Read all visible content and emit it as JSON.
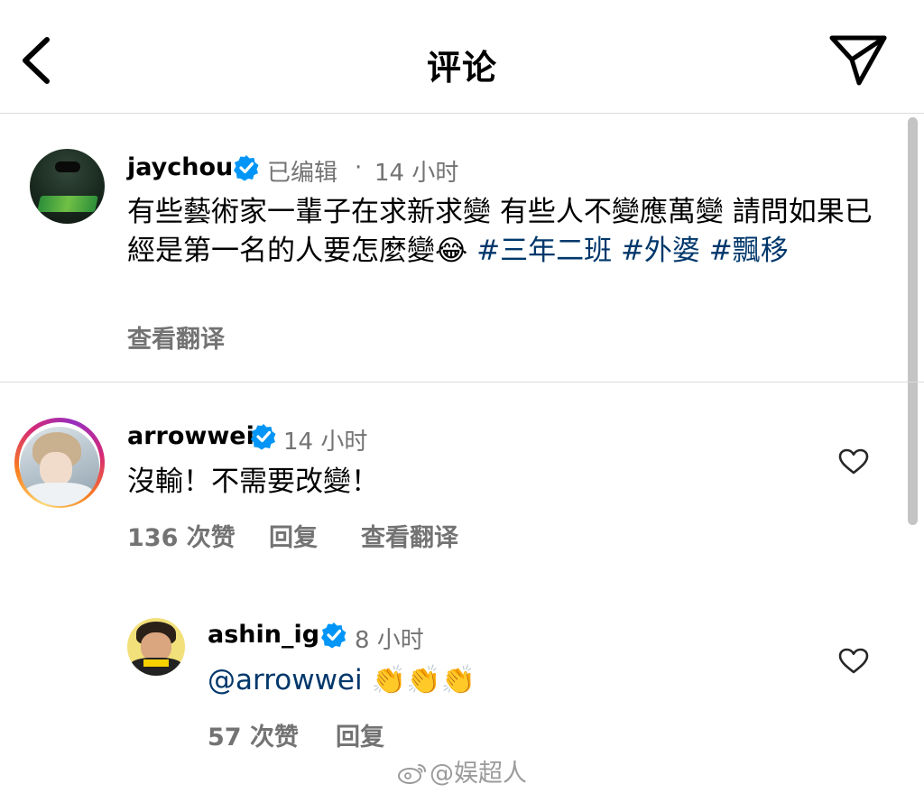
{
  "header": {
    "title": "评论"
  },
  "post": {
    "username": "jaychou",
    "edited": "已编辑",
    "separator": "·",
    "time": "14 小时",
    "text": "有些藝術家一輩子在求新求變 有些人不變應萬變 請問如果已經是第一名的人要怎麼變",
    "laugh_emoji": "😂",
    "hashtags": [
      "#三年二班",
      "#外婆",
      "#飄移"
    ],
    "translate": "查看翻译"
  },
  "comments": [
    {
      "username": "arrowwei",
      "time": "14 小时",
      "text": "沒輸！不需要改變！",
      "likes": "136 次赞",
      "reply": "回复",
      "translate": "查看翻译"
    },
    {
      "username": "ashin_ig",
      "time": "8 小时",
      "mention": "@arrowwei",
      "emojis": "👏👏👏",
      "likes": "57 次赞",
      "reply": "回复"
    }
  ],
  "watermark": "@娱超人",
  "icons": {
    "back": "chevron-left-icon",
    "share": "paper-plane-icon",
    "verified": "verified-badge-icon",
    "like": "heart-outline-icon"
  },
  "colors": {
    "hashtag": "#00376b",
    "secondary_text": "#737373",
    "verified": "#0095f6",
    "divider": "#dbdbdb"
  }
}
